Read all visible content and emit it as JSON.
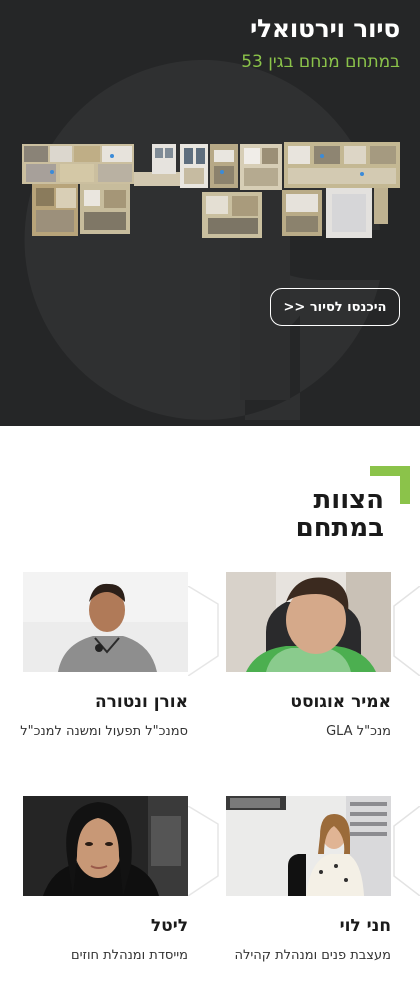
{
  "hero": {
    "title": "סיור וירטואלי",
    "subtitle": "במתחם מנחם בגין 53",
    "enter_button": "היכנסו לסיור <<"
  },
  "team": {
    "title_line1": "הצוות",
    "title_line2": "במתחם",
    "members": [
      {
        "name": "אמיר אוגוסט",
        "role": "מנכ\"ל GLA"
      },
      {
        "name": "אורן ונטורה",
        "role": "סמנכ\"ל תפעול ומשנה למנכ\"ל"
      },
      {
        "name": "חני לוי",
        "role": "מעצבת פנים ומנהלת קהילה"
      },
      {
        "name": "ליטל",
        "role": "מייסדת ומנהלת חוזים"
      }
    ]
  },
  "colors": {
    "hero_bg": "#252627",
    "accent_green": "#8bc34a",
    "text_dark": "#1b1b1b"
  }
}
